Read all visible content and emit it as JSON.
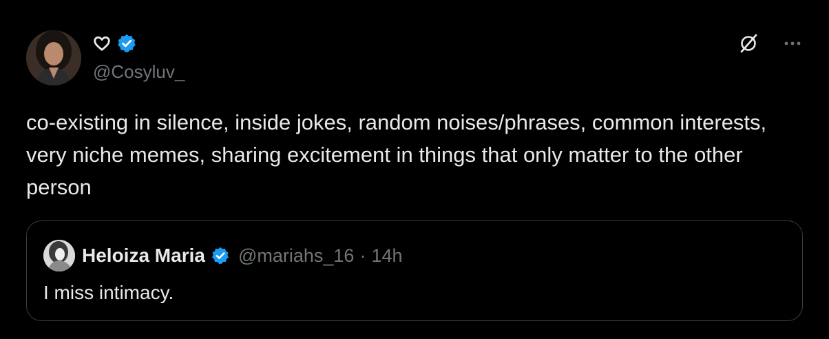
{
  "tweet": {
    "display_name_icon": "heart-outline-icon",
    "verified_icon": "verified-badge-icon",
    "handle": "@Cosyluv_",
    "text": "co-existing in silence, inside jokes, random noises/phrases, common interests, very niche memes, sharing excitement in things that only matter to the other person",
    "icons": {
      "grok": "grok-slash-icon",
      "more": "more-options-icon"
    }
  },
  "quoted_tweet": {
    "name": "Heloiza Maria",
    "handle": "@mariahs_16",
    "separator": "·",
    "time": "14h",
    "text": "I miss intimacy."
  },
  "colors": {
    "background": "#000000",
    "text_primary": "#e7e9ea",
    "text_secondary": "#71767b",
    "verified_blue": "#1d9bf0",
    "border": "#3a3d40"
  }
}
